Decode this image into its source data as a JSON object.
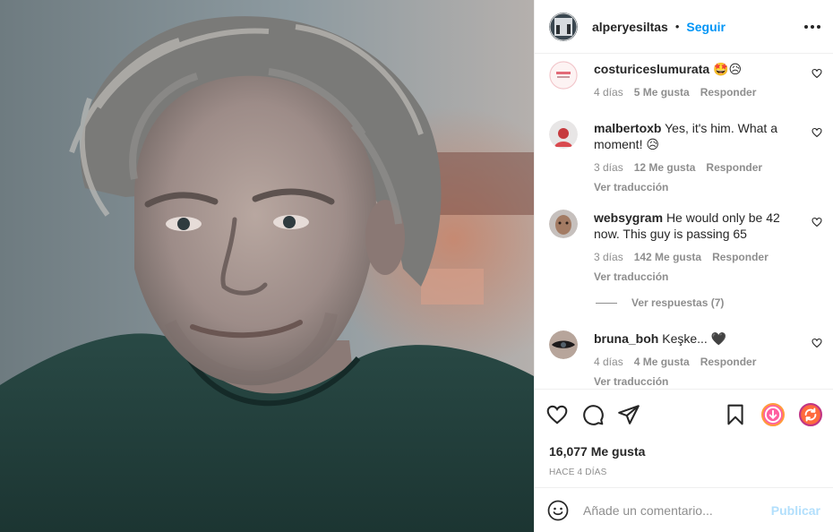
{
  "post": {
    "username": "alperyesiltas",
    "separator": "•",
    "follow_label": "Seguir",
    "more_icon": "more-horizontal-icon",
    "likes": "16,077 Me gusta",
    "timestamp": "HACE 4 DÍAS",
    "photo_description_icon": "portrait-photo"
  },
  "comments": [
    {
      "username": "costuriceslumurata",
      "text": "🤩😥",
      "age": "4 días",
      "likes": "5 Me gusta",
      "reply": "Responder",
      "translate": ""
    },
    {
      "username": "malbertoxb",
      "text": "Yes, it's him. What a moment! 😥",
      "age": "3 días",
      "likes": "12 Me gusta",
      "reply": "Responder",
      "translate": "Ver traducción"
    },
    {
      "username": "websygram",
      "text": "He would only be 42 now. This guy is passing 65",
      "age": "3 días",
      "likes": "142 Me gusta",
      "reply": "Responder",
      "translate": "Ver traducción"
    },
    {
      "username": "bruna_boh",
      "text": "Keşke... 🖤",
      "age": "4 días",
      "likes": "4 Me gusta",
      "reply": "Responder",
      "translate": "Ver traducción"
    }
  ],
  "view_replies": "Ver respuestas (7)",
  "composer": {
    "placeholder": "Añade un comentario...",
    "post_label": "Publicar"
  },
  "colors": {
    "link": "#0095f6",
    "muted": "#8e8e8e",
    "text": "#262626",
    "publish_disabled": "#b2dffc"
  }
}
